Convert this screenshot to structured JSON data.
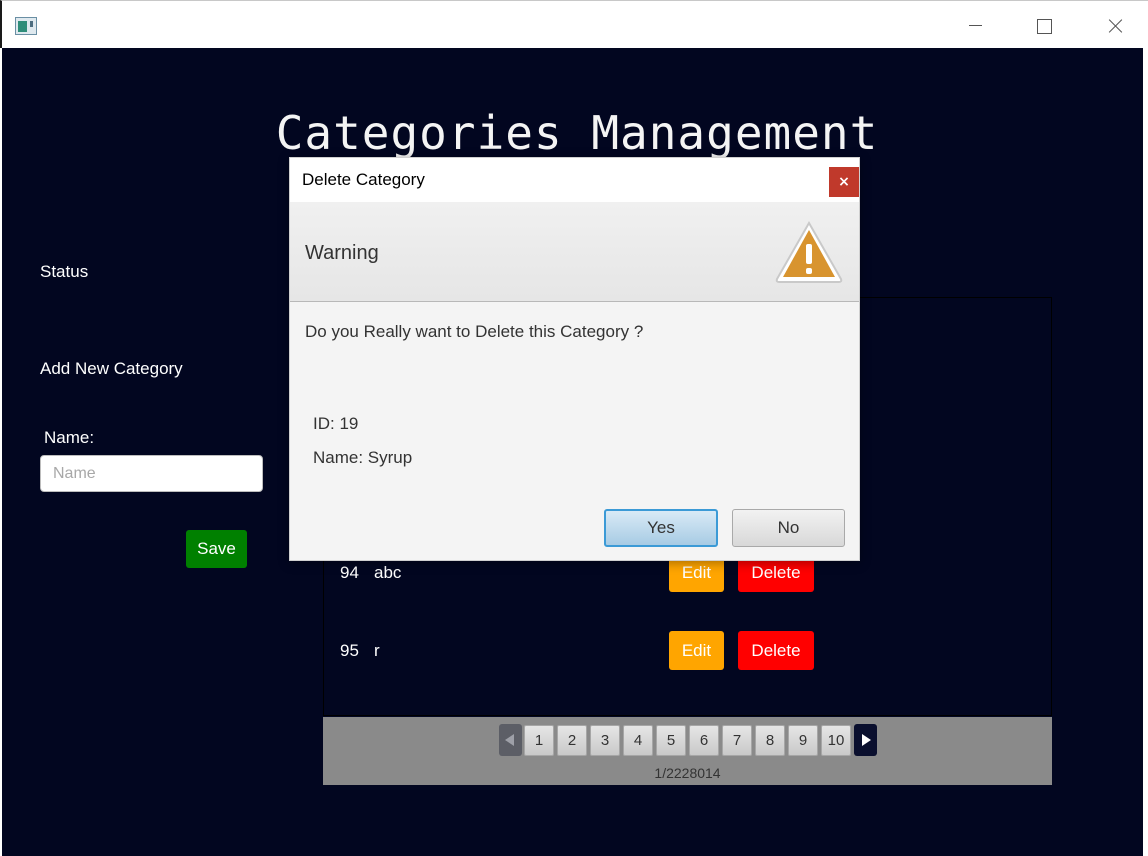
{
  "window": {
    "icons": {
      "app": "app-window-icon",
      "minimize": "minimize-icon",
      "maximize": "maximize-icon",
      "close": "close-icon"
    }
  },
  "page": {
    "title": "Categories Management"
  },
  "sidebar": {
    "status_label": "Status",
    "add_label": "Add New Category",
    "name_label": "Name:",
    "name_placeholder": "Name",
    "name_value": "",
    "save_label": "Save"
  },
  "table": {
    "rows": [
      {
        "id": "94",
        "name": "abc",
        "edit_label": "Edit",
        "delete_label": "Delete"
      },
      {
        "id": "95",
        "name": "r",
        "edit_label": "Edit",
        "delete_label": "Delete"
      }
    ]
  },
  "pagination": {
    "pages": [
      "1",
      "2",
      "3",
      "4",
      "5",
      "6",
      "7",
      "8",
      "9",
      "10"
    ],
    "current_page": "1",
    "info": "1/2228014",
    "icons": {
      "prev": "chevron-left-icon",
      "next": "chevron-right-icon"
    }
  },
  "dialog": {
    "title": "Delete Category",
    "close_label": "×",
    "header": "Warning",
    "message": "Do you Really want to Delete this Category ?",
    "id_line": "ID: 19",
    "name_line": "Name: Syrup",
    "yes_label": "Yes",
    "no_label": "No",
    "icon": "warning-icon"
  },
  "colors": {
    "app_background": "#020620",
    "save": "#008000",
    "edit": "#ffa500",
    "delete": "#ff0000",
    "warning": "#d8942f",
    "dialog_close": "#c0392b",
    "default_button_border": "#3b9ad6"
  }
}
